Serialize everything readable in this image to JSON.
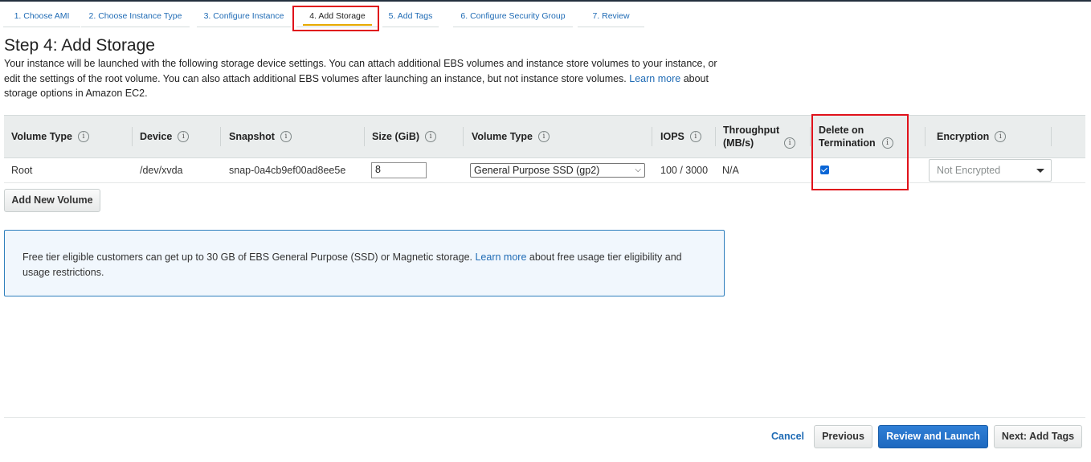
{
  "wizard": {
    "tabs": [
      {
        "label": "1. Choose AMI"
      },
      {
        "label": "2. Choose Instance Type"
      },
      {
        "label": "3. Configure Instance"
      },
      {
        "label": "4. Add Storage"
      },
      {
        "label": "5. Add Tags"
      },
      {
        "label": "6. Configure Security Group"
      },
      {
        "label": "7. Review"
      }
    ],
    "active_tab": "4. Add Storage"
  },
  "page": {
    "title": "Step 4: Add Storage",
    "intro_text_1": "Your instance will be launched with the following storage device settings. You can attach additional EBS volumes and instance store volumes to your instance, or edit the settings of the root volume. You can also attach additional EBS volumes after launching an instance, but not instance store volumes.",
    "intro_link": "Learn more",
    "intro_text_2": "about storage options in Amazon EC2."
  },
  "storage_table": {
    "headers": {
      "volume_type": "Volume Type",
      "device": "Device",
      "snapshot": "Snapshot",
      "size": "Size (GiB)",
      "volume_type_2": "Volume Type",
      "iops": "IOPS",
      "throughput_line1": "Throughput",
      "throughput_line2": "(MB/s)",
      "delete_line1": "Delete on",
      "delete_line2": "Termination",
      "encryption": "Encryption"
    },
    "rows": [
      {
        "volume_type": "Root",
        "device": "/dev/xvda",
        "snapshot": "snap-0a4cb9ef00ad8ee5e",
        "size": "8",
        "ebs_type": "General Purpose SSD (gp2)",
        "iops": "100 / 3000",
        "throughput": "N/A",
        "delete_on_termination": true,
        "encryption": "Not Encrypted"
      }
    ]
  },
  "buttons": {
    "add_volume": "Add New Volume",
    "cancel": "Cancel",
    "previous": "Previous",
    "review_launch": "Review and Launch",
    "next": "Next: Add Tags"
  },
  "free_tier": {
    "text_1": "Free tier eligible customers can get up to 30 GB of EBS General Purpose (SSD) or Magnetic storage.",
    "link": "Learn more",
    "text_2": "about free usage tier eligibility and usage restrictions."
  },
  "icons": {
    "info": "info-icon",
    "dropdown": "chevron-down-icon",
    "checkbox": "check-icon"
  },
  "colors": {
    "link": "#1f6bb5",
    "highlight": "#e0121b",
    "active_underline": "#e7a900",
    "primary_button": "#1d68bf",
    "info_box_bg": "#f1f7fd"
  }
}
